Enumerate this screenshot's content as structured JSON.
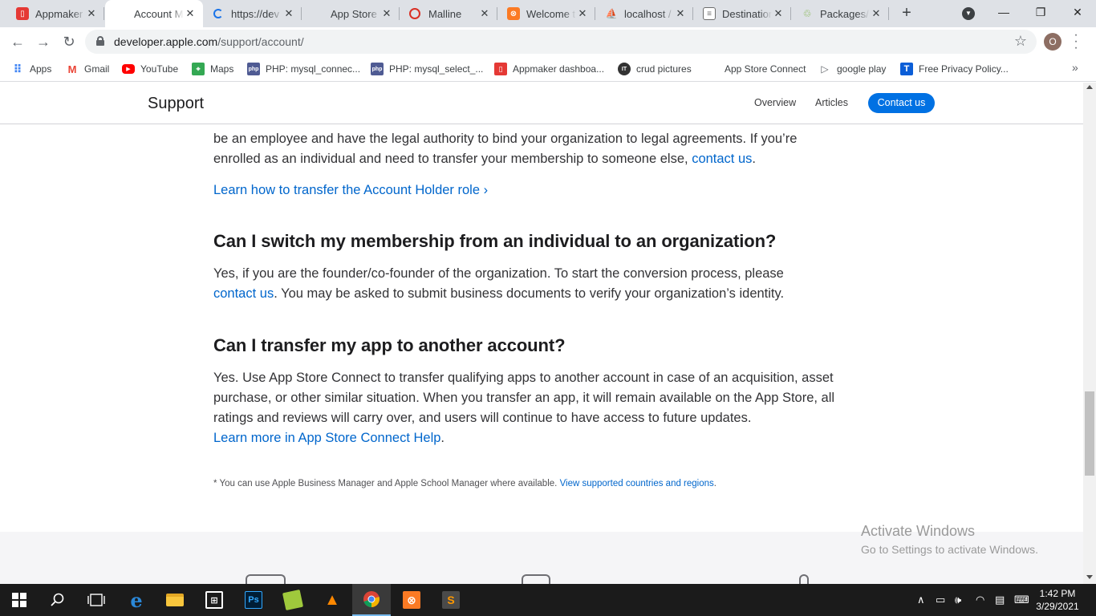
{
  "browser": {
    "tabs": [
      {
        "title": "Appmaker",
        "icon": "appmaker-icon",
        "color": "#e53935"
      },
      {
        "title": "Account M",
        "icon": "apple-icon",
        "color": "#555555",
        "active": true
      },
      {
        "title": "https://dev",
        "icon": "loading-icon",
        "color": "#1a73e8"
      },
      {
        "title": "App Store C",
        "icon": "apple-icon",
        "color": "#555555"
      },
      {
        "title": "Malline",
        "icon": "circle-icon",
        "color": "#d93025"
      },
      {
        "title": "Welcome t",
        "icon": "xampp-icon",
        "color": "#fb7a24"
      },
      {
        "title": "localhost /",
        "icon": "phpmyadmin-icon",
        "color": "#f57c00"
      },
      {
        "title": "Destination",
        "icon": "document-icon",
        "color": "#6d6d6d"
      },
      {
        "title": "Packages/S",
        "icon": "packages-icon",
        "color": "#7cb342"
      }
    ],
    "url_host": "developer.apple.com",
    "url_path": "/support/account/",
    "profile_initial": "O"
  },
  "bookmarks": [
    {
      "label": "Apps",
      "icon": "apps-grid-icon",
      "color": "#4285f4"
    },
    {
      "label": "Gmail",
      "icon": "gmail-icon",
      "color": "#ea4335"
    },
    {
      "label": "YouTube",
      "icon": "youtube-icon",
      "color": "#ff0000"
    },
    {
      "label": "Maps",
      "icon": "maps-icon",
      "color": "#34a853"
    },
    {
      "label": "PHP: mysql_connec...",
      "icon": "php-icon",
      "color": "#4f5b93"
    },
    {
      "label": "PHP: mysql_select_...",
      "icon": "php-icon",
      "color": "#4f5b93"
    },
    {
      "label": "Appmaker dashboa...",
      "icon": "appmaker-icon",
      "color": "#e53935"
    },
    {
      "label": "crud pictures",
      "icon": "crud-icon",
      "color": "#333333"
    },
    {
      "label": "App Store Connect",
      "icon": "apple-icon",
      "color": "#555555"
    },
    {
      "label": "google play",
      "icon": "google-play-icon",
      "color": "#5f6368"
    },
    {
      "label": "Free Privacy Policy...",
      "icon": "t-icon",
      "color": "#0b5ed7"
    }
  ],
  "site": {
    "brand": "Support",
    "nav": [
      "Overview",
      "Articles"
    ],
    "cta": "Contact us"
  },
  "content": {
    "p1_line1": "be an employee and have the legal authority to bind your organization to legal agreements. If you’re",
    "p1_line2_text": "enrolled as an individual and need to transfer your membership to someone else, ",
    "p1_link": "contact us",
    "p1_end": ".",
    "transfer_link": "Learn how to transfer the Account Holder role ›",
    "q1": "Can I switch my membership from an individual to an organization?",
    "a1_line1": "Yes, if you are the founder/co-founder of the organization. To start the conversion process, please",
    "a1_link": "contact us",
    "a1_rest": ". You may be asked to submit business documents to verify your organization’s identity.",
    "q2": "Can I transfer my app to another account?",
    "a2_line1": "Yes. Use App Store Connect to transfer qualifying apps to another account in case of an acquisition, asset",
    "a2_line2": "purchase, or other similar situation. When you transfer an app, it will remain available on the App Store, all",
    "a2_line3": "ratings and reviews will carry over, and users will continue to have access to future updates.",
    "a2_link": "Learn more in App Store Connect Help",
    "a2_end": ".",
    "footnote": "* You can use Apple Business Manager and Apple School Manager where available. ",
    "footnote_link": "View supported countries and regions",
    "footnote_end": "."
  },
  "watermark": {
    "line1": "Activate Windows",
    "line2": "Go to Settings to activate Windows."
  },
  "taskbar": {
    "apps": [
      {
        "name": "edge",
        "icon": "edge-icon",
        "color": "#0078d7",
        "glyph": "e"
      },
      {
        "name": "explorer",
        "icon": "folder-icon",
        "color": "#f8c63d",
        "glyph": ""
      },
      {
        "name": "store",
        "icon": "store-icon",
        "color": "#2b2b2b",
        "glyph": "⊞"
      },
      {
        "name": "photoshop",
        "icon": "photoshop-icon",
        "color": "#001e36",
        "glyph": "Ps"
      },
      {
        "name": "files",
        "icon": "files-icon",
        "color": "#9fc93c",
        "glyph": ""
      },
      {
        "name": "vlc",
        "icon": "vlc-icon",
        "color": "#ff8800",
        "glyph": "▲"
      },
      {
        "name": "chrome",
        "icon": "chrome-icon",
        "color": "#db4437",
        "glyph": "",
        "active": true
      },
      {
        "name": "xampp",
        "icon": "xampp-icon",
        "color": "#fb7a24",
        "glyph": "⊗"
      },
      {
        "name": "sublime",
        "icon": "sublime-icon",
        "color": "#ff9800",
        "glyph": "S"
      }
    ],
    "time": "1:42 PM",
    "date": "3/29/2021"
  }
}
